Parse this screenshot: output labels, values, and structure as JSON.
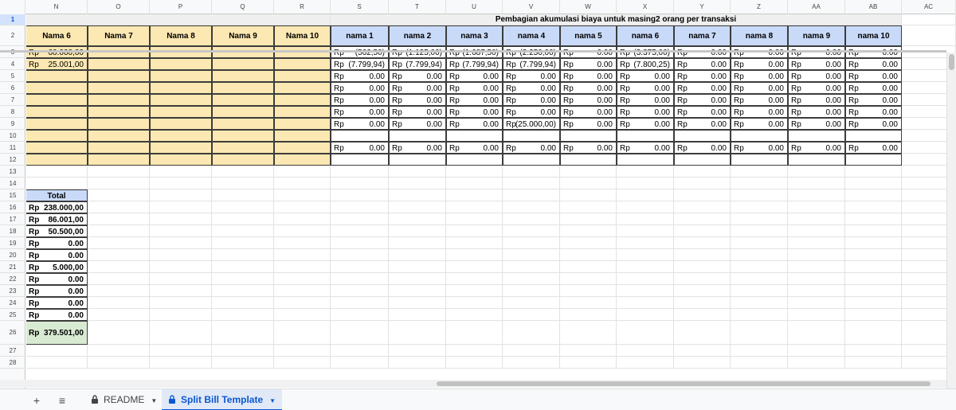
{
  "columns": [
    "N",
    "O",
    "P",
    "Q",
    "R",
    "S",
    "T",
    "U",
    "V",
    "W",
    "X",
    "Y",
    "Z",
    "AA",
    "AB",
    "AC"
  ],
  "rows": [
    "1",
    "2",
    "3",
    "4",
    "5",
    "6",
    "7",
    "8",
    "9",
    "10",
    "11",
    "12",
    "13",
    "14",
    "15",
    "16",
    "17",
    "18",
    "19",
    "20",
    "21",
    "22",
    "23",
    "24",
    "25",
    "26",
    "27",
    "28"
  ],
  "title": "Pembagian akumulasi biaya untuk masing2 orang per transaksi",
  "left_headers": [
    "Nama 6",
    "Nama 7",
    "Nama 8",
    "Nama 9",
    "Nama 10"
  ],
  "right_headers": [
    "nama 1",
    "nama 2",
    "nama 3",
    "nama 4",
    "nama 5",
    "nama 6",
    "nama 7",
    "nama 8",
    "nama 9",
    "nama 10"
  ],
  "currency": "Rp",
  "nama6_values": [
    "60.000,00",
    "25.001,00"
  ],
  "split_rows": [
    {
      "row": "3",
      "vals": [
        "(562,50)",
        "(1.125,00)",
        "(1.687,50)",
        "(2.250,00)",
        "0.00",
        "(3.375,00)",
        "0.00",
        "0.00",
        "0.00",
        "0.00"
      ]
    },
    {
      "row": "4",
      "vals": [
        "(7.799,94)",
        "(7.799,94)",
        "(7.799,94)",
        "(7.799,94)",
        "0.00",
        "(7.800,25)",
        "0.00",
        "0.00",
        "0.00",
        "0.00"
      ]
    },
    {
      "row": "5",
      "vals": [
        "0.00",
        "0.00",
        "0.00",
        "0.00",
        "0.00",
        "0.00",
        "0.00",
        "0.00",
        "0.00",
        "0.00"
      ]
    },
    {
      "row": "6",
      "vals": [
        "0.00",
        "0.00",
        "0.00",
        "0.00",
        "0.00",
        "0.00",
        "0.00",
        "0.00",
        "0.00",
        "0.00"
      ]
    },
    {
      "row": "7",
      "vals": [
        "0.00",
        "0.00",
        "0.00",
        "0.00",
        "0.00",
        "0.00",
        "0.00",
        "0.00",
        "0.00",
        "0.00"
      ]
    },
    {
      "row": "8",
      "vals": [
        "0.00",
        "0.00",
        "0.00",
        "0.00",
        "0.00",
        "0.00",
        "0.00",
        "0.00",
        "0.00",
        "0.00"
      ]
    },
    {
      "row": "9",
      "vals": [
        "0.00",
        "0.00",
        "0.00",
        "(25.000,00)",
        "0.00",
        "0.00",
        "0.00",
        "0.00",
        "0.00",
        "0.00"
      ]
    },
    {
      "row": "11",
      "vals": [
        "0.00",
        "0.00",
        "0.00",
        "0.00",
        "0.00",
        "0.00",
        "0.00",
        "0.00",
        "0.00",
        "0.00"
      ]
    }
  ],
  "total_label": "Total",
  "totals": [
    "238.000,00",
    "86.001,00",
    "50.500,00",
    "0.00",
    "0.00",
    "5.000,00",
    "0.00",
    "0.00",
    "0.00",
    "0.00"
  ],
  "grand_total": "379.501,00",
  "sheet_tabs": [
    {
      "label": "README",
      "active": false
    },
    {
      "label": "Split Bill Template",
      "active": true
    }
  ],
  "add_sheet_icon": "+",
  "all_sheets_icon": "≡",
  "colors": {
    "yellow": "#fce8b2",
    "blue": "#c9daf8",
    "green": "#d9ead3",
    "accent": "#0b57d0"
  }
}
